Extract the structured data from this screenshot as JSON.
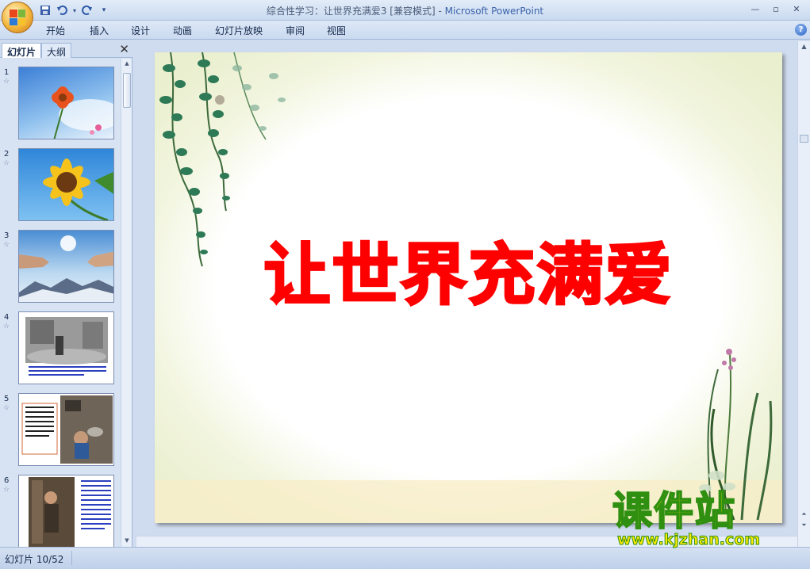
{
  "window": {
    "title_doc": "综合性学习：让世界充满爱3 [兼容模式] - ",
    "title_app": "Microsoft PowerPoint"
  },
  "ribbon": {
    "tabs": [
      "开始",
      "插入",
      "设计",
      "动画",
      "幻灯片放映",
      "审阅",
      "视图"
    ]
  },
  "left_pane": {
    "tabs": [
      "幻灯片",
      "大纲"
    ],
    "active_tab": "幻灯片",
    "slides": [
      {
        "number": "1"
      },
      {
        "number": "2"
      },
      {
        "number": "3"
      },
      {
        "number": "4"
      },
      {
        "number": "5"
      },
      {
        "number": "6"
      }
    ]
  },
  "slide": {
    "title": "让世界充满爱"
  },
  "watermark": {
    "main": "课件站",
    "url": "www.kjzhan.com"
  },
  "status": {
    "slide_counter": "幻灯片 10/52"
  },
  "colors": {
    "slide_title": "#ff0000",
    "watermark_fill": "#ffec00",
    "watermark_stroke": "#2f8f10",
    "ribbon_bg": "#cbdaf0"
  },
  "icons": [
    "office-button-icon",
    "save-icon",
    "undo-icon",
    "redo-icon",
    "customize-qat-icon",
    "minimize-icon",
    "maximize-icon",
    "close-icon",
    "help-icon",
    "pane-close-icon"
  ]
}
